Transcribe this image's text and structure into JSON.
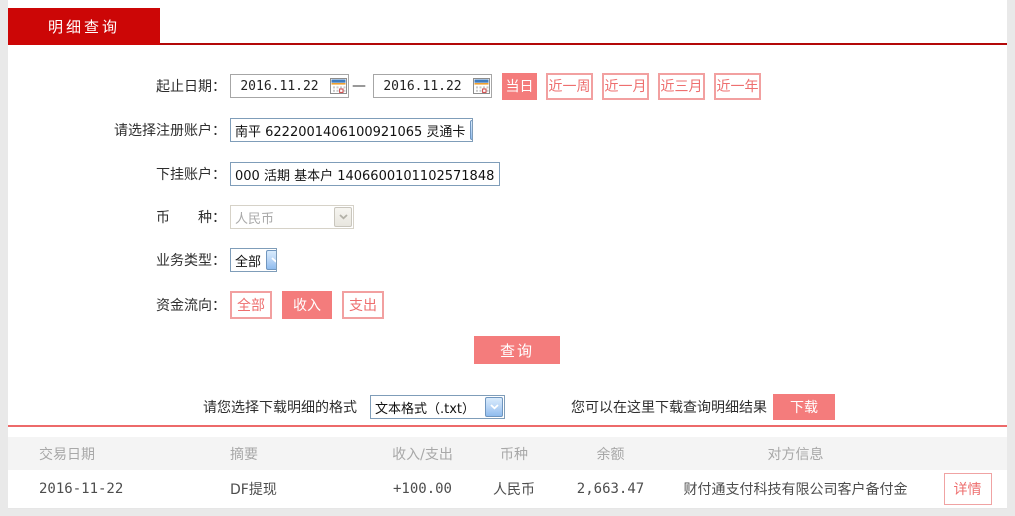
{
  "tab": {
    "label": "明细查询"
  },
  "form": {
    "date_range": {
      "label": "起止日期：",
      "start_value": "2016.11.22",
      "end_value": "2016.11.22",
      "separator": "—"
    },
    "quick_ranges": [
      {
        "label": "当日",
        "active": true
      },
      {
        "label": "近一周",
        "active": false
      },
      {
        "label": "近一月",
        "active": false
      },
      {
        "label": "近三月",
        "active": false
      },
      {
        "label": "近一年",
        "active": false
      }
    ],
    "register_account": {
      "label": "请选择注册账户：",
      "value": "南平 6222001406100921065 灵通卡"
    },
    "sub_account": {
      "label": "下挂账户：",
      "value": "000 活期 基本户 1406600101102571848"
    },
    "currency": {
      "label": "币　　种：",
      "value": "人民币",
      "disabled": true
    },
    "business_type": {
      "label": "业务类型：",
      "value": "全部"
    },
    "fund_flow": {
      "label": "资金流向：",
      "options": [
        {
          "label": "全部",
          "active": false
        },
        {
          "label": "收入",
          "active": true
        },
        {
          "label": "支出",
          "active": false
        }
      ]
    },
    "query_button_label": "查询",
    "download": {
      "format_label": "请您选择下载明细的格式",
      "format_value": "文本格式（.txt）",
      "hint": "您可以在这里下载查询明细结果",
      "button_label": "下载"
    }
  },
  "table": {
    "headers": [
      "交易日期",
      "摘要",
      "收入/支出",
      "币种",
      "余额",
      "对方信息"
    ],
    "rows": [
      {
        "date": "2016-11-22",
        "summary": "DF提现",
        "amount": "+100.00",
        "currency": "人民币",
        "balance": "2,663.47",
        "counterparty": "财付通支付科技有限公司客户备付金",
        "detail_label": "详情"
      }
    ]
  },
  "icons": {
    "calendar": "calendar-icon",
    "dropdown_arrow": "chevron-down-icon"
  },
  "colors": {
    "brand_red": "#cc0606",
    "tab_underline": "#b30808",
    "accent_pink": "#f47c7c",
    "outline_pink": "#f2a0a0",
    "accent_text_red": "#ee6f6f",
    "amount_red": "#dd0000",
    "separator_red": "#ed6a6a",
    "header_text_gray": "#a8a8a8",
    "page_background": "#e9e9e9"
  }
}
